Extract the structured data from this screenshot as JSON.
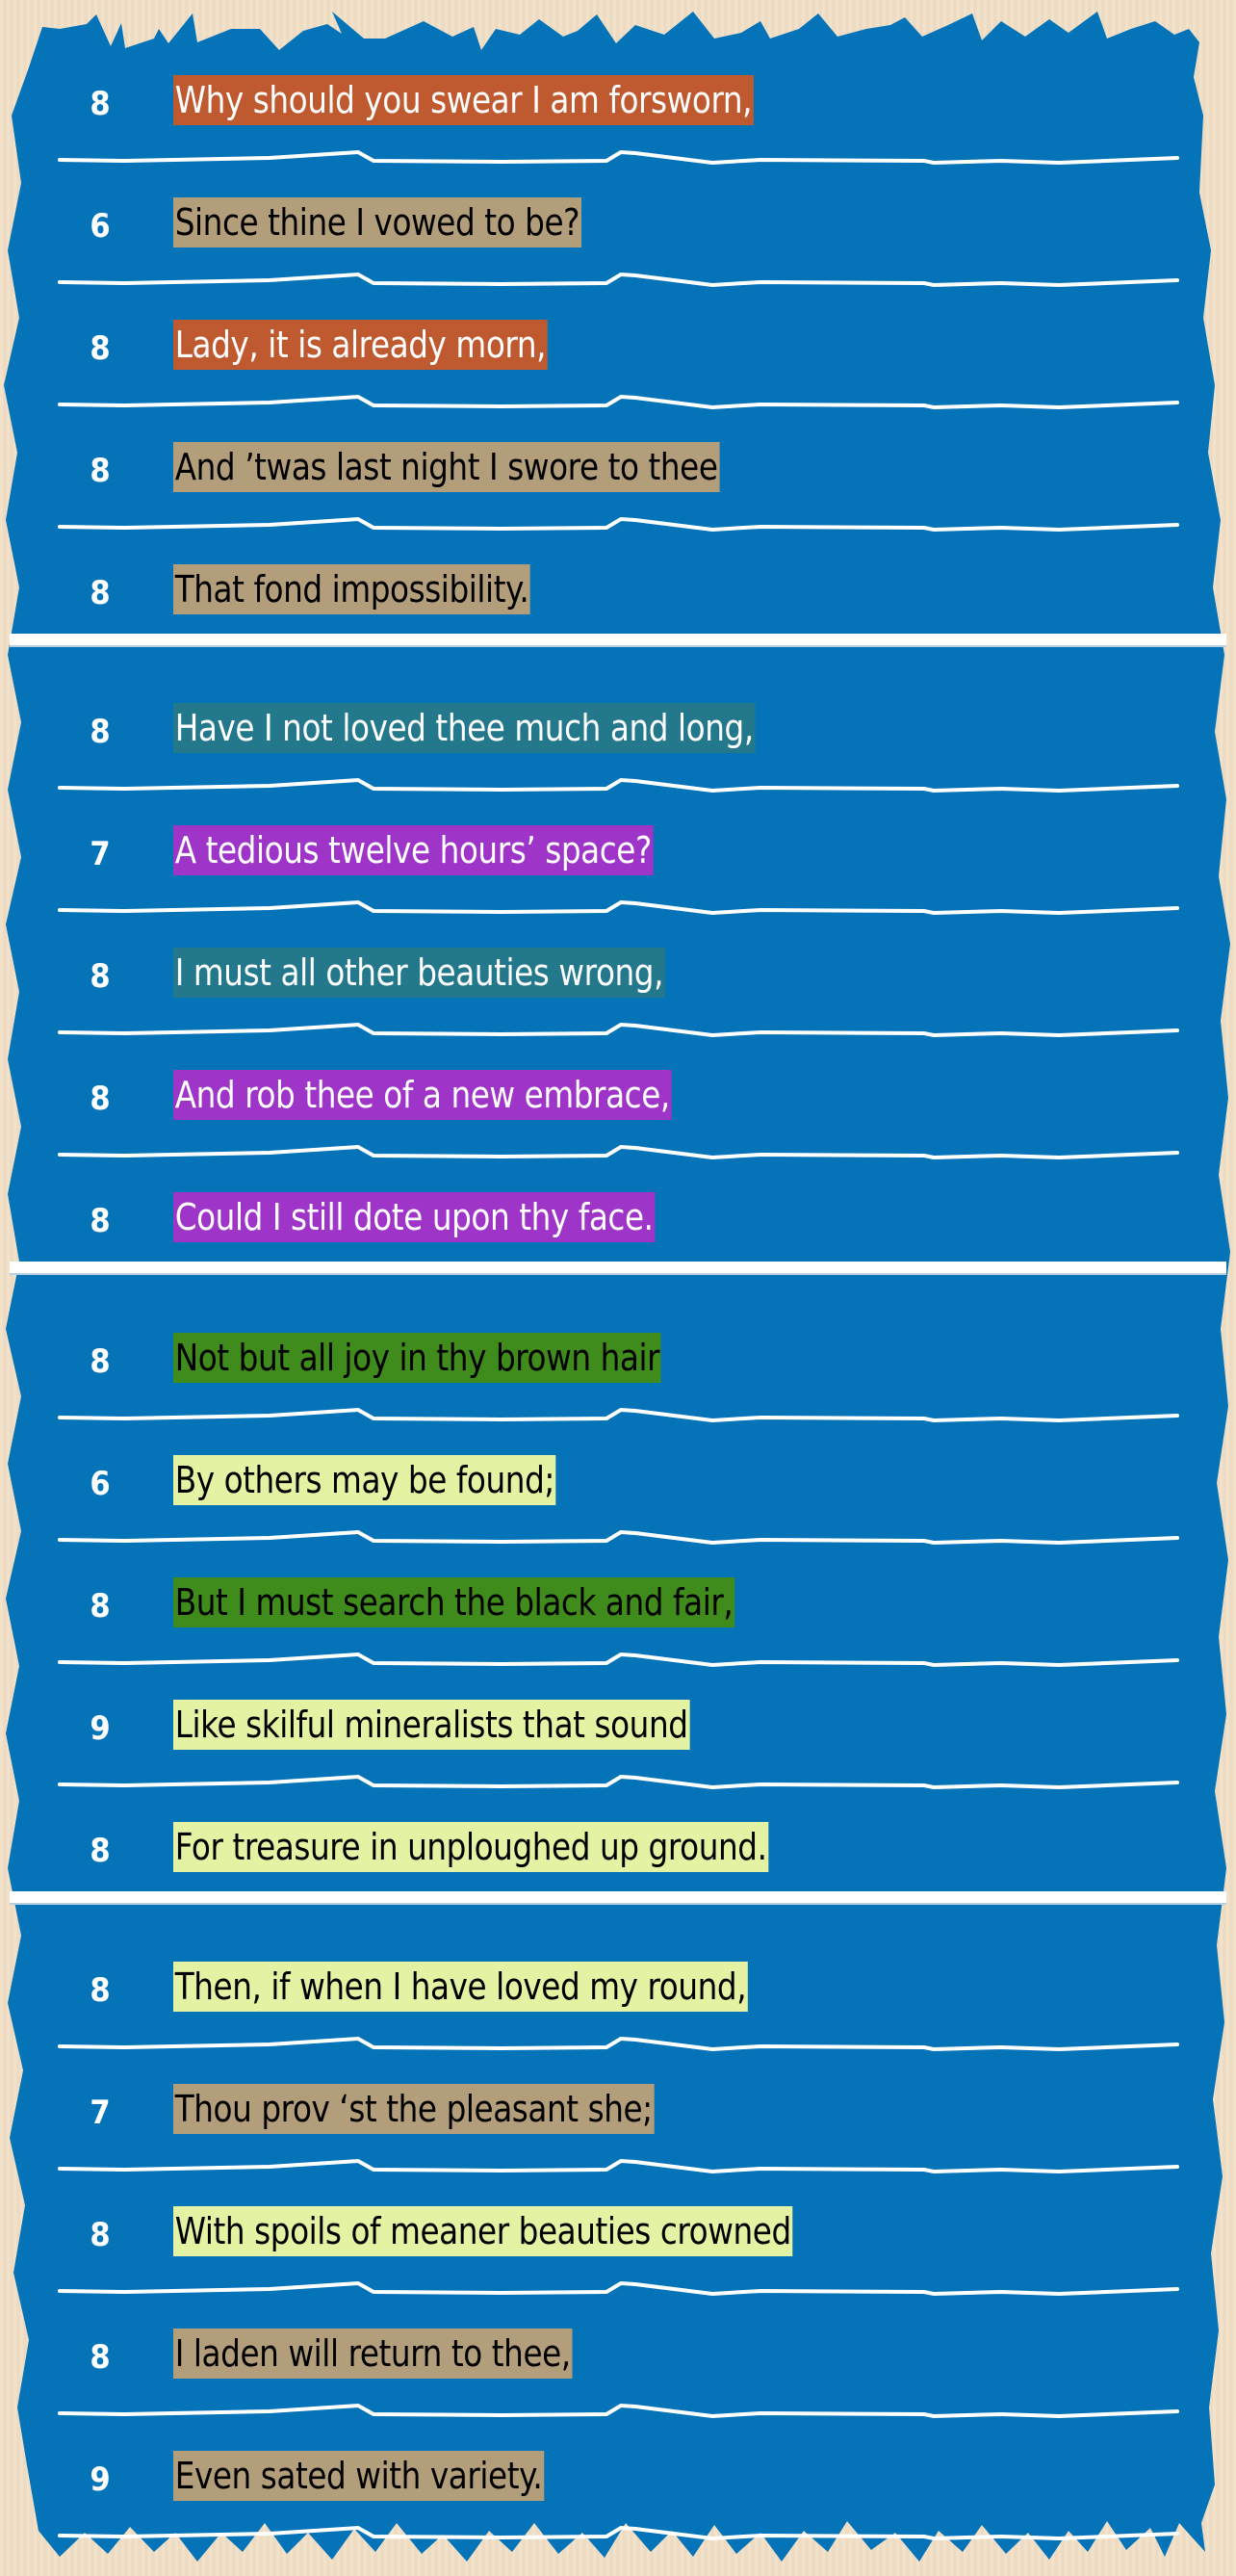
{
  "colors": {
    "background": "#f1e0c6",
    "panel": "#0573b8",
    "separator": "#ffffff",
    "highlights": {
      "rust": "#bf5a30",
      "tan": "#b39e7c",
      "teal": "#23788c",
      "purple": "#9e34c8",
      "green": "#3f8b1c",
      "lime": "#e4f3a3"
    }
  },
  "stanzas": [
    {
      "lines": [
        {
          "syllables": "8",
          "text": "Why should you swear I am forsworn,",
          "highlight": "rust"
        },
        {
          "syllables": "6",
          "text": "Since thine I vowed to be?",
          "highlight": "tan"
        },
        {
          "syllables": "8",
          "text": "Lady, it is already morn,",
          "highlight": "rust"
        },
        {
          "syllables": "8",
          "text": "And ’twas last night I swore to thee",
          "highlight": "tan"
        },
        {
          "syllables": "8",
          "text": "That fond impossibility.",
          "highlight": "tan"
        }
      ]
    },
    {
      "lines": [
        {
          "syllables": "8",
          "text": "Have I not loved thee much and long,",
          "highlight": "teal"
        },
        {
          "syllables": "7",
          "text": "A tedious twelve hours’ space?",
          "highlight": "purple"
        },
        {
          "syllables": "8",
          "text": "I must all other beauties wrong,",
          "highlight": "teal"
        },
        {
          "syllables": "8",
          "text": "And rob thee of a new embrace,",
          "highlight": "purple"
        },
        {
          "syllables": "8",
          "text": "Could I still dote upon thy face.",
          "highlight": "purple"
        }
      ]
    },
    {
      "lines": [
        {
          "syllables": "8",
          "text": "Not but all joy in thy brown hair",
          "highlight": "green"
        },
        {
          "syllables": "6",
          "text": "By others may be found;",
          "highlight": "lime"
        },
        {
          "syllables": "8",
          "text": "But I must search the black and fair,",
          "highlight": "green"
        },
        {
          "syllables": "9",
          "text": "Like skilful mineralists that sound",
          "highlight": "lime"
        },
        {
          "syllables": "8",
          "text": "For treasure in unploughed up ground.",
          "highlight": "lime"
        }
      ]
    },
    {
      "lines": [
        {
          "syllables": "8",
          "text": "Then, if when I have loved my round,",
          "highlight": "lime"
        },
        {
          "syllables": "7",
          "text": "Thou prov ‘st the pleasant she;",
          "highlight": "tan"
        },
        {
          "syllables": "8",
          "text": "With spoils of meaner beauties crowned",
          "highlight": "lime"
        },
        {
          "syllables": "8",
          "text": "I laden will return to thee,",
          "highlight": "tan"
        },
        {
          "syllables": "9",
          "text": "Even sated with variety.",
          "highlight": "tan"
        }
      ]
    }
  ]
}
